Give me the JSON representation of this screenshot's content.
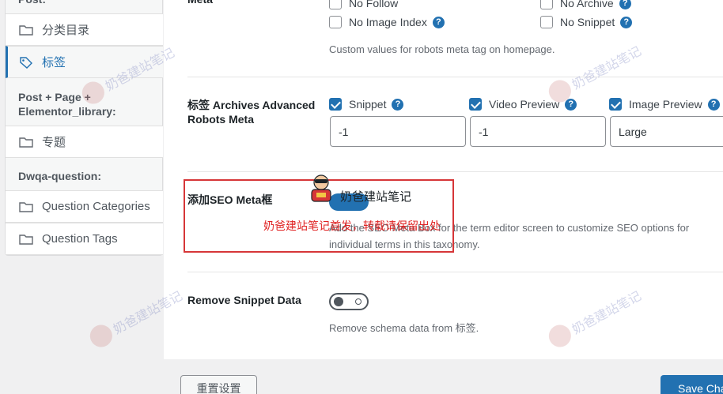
{
  "sidebar": {
    "heading_post": "Post:",
    "items_post": [
      {
        "label": "分类目录"
      },
      {
        "label": "标签"
      }
    ],
    "heading_post_page": "Post + Page +",
    "heading_post_page_2": "Elementor_library:",
    "items_post_page": [
      {
        "label": "专题"
      }
    ],
    "heading_dwqa": "Dwqa-question:",
    "items_dwqa": [
      {
        "label": "Question Categories"
      },
      {
        "label": "Question Tags"
      }
    ]
  },
  "robots_meta": {
    "label": "Meta",
    "options": [
      {
        "label": "No Follow",
        "checked": false
      },
      {
        "label": "No Archive",
        "checked": false
      },
      {
        "label": "No Image Index",
        "checked": false
      },
      {
        "label": "No Snippet",
        "checked": false
      }
    ],
    "description": "Custom values for robots meta tag on homepage."
  },
  "advanced_robots": {
    "label_line1": "标签 Archives Advanced",
    "label_line2": "Robots Meta",
    "options": [
      {
        "label": "Snippet",
        "checked": true,
        "value": "-1"
      },
      {
        "label": "Video Preview",
        "checked": true,
        "value": "-1"
      },
      {
        "label": "Image Preview",
        "checked": true,
        "value": "Large"
      }
    ]
  },
  "seo_meta_box": {
    "label": "添加SEO Meta框",
    "enabled": true,
    "description_1": "Add the SEO Meta Box for the term editor screen to customize SEO options for",
    "description_2": "individual terms in this taxonomy."
  },
  "remove_snippet": {
    "label": "Remove Snippet Data",
    "enabled": false,
    "description": "Remove schema data from 标签."
  },
  "footer": {
    "reset_label": "重置设置",
    "save_label": "Save Changes"
  },
  "watermarks": {
    "brand": "奶爸建站笔记",
    "notice": "奶爸建站笔记首发，转载请保留出处"
  }
}
